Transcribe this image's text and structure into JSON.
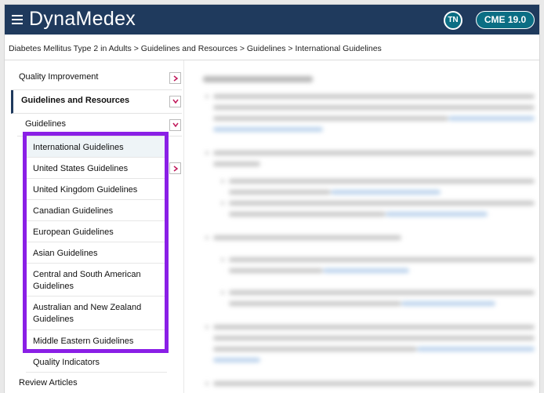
{
  "app": {
    "title": "DynaMedex"
  },
  "header": {
    "avatar_initials": "TN",
    "cme_label": "CME 19.0"
  },
  "breadcrumb": "Diabetes Mellitus Type 2 in Adults > Guidelines and Resources > Guidelines > International Guidelines",
  "sidebar": {
    "items": [
      {
        "label": "Quality Improvement"
      },
      {
        "label": "Guidelines and Resources"
      },
      {
        "label": "Guidelines"
      }
    ],
    "guidelines": [
      {
        "label": "International Guidelines"
      },
      {
        "label": "United States Guidelines"
      },
      {
        "label": "United Kingdom Guidelines"
      },
      {
        "label": "Canadian Guidelines"
      },
      {
        "label": "European Guidelines"
      },
      {
        "label": "Asian Guidelines"
      },
      {
        "label": "Central and South American Guidelines"
      },
      {
        "label": "Australian and New Zealand Guidelines"
      },
      {
        "label": "Middle Eastern Guidelines"
      },
      {
        "label": "Quality Indicators"
      }
    ],
    "review_articles": "Review Articles"
  },
  "colors": {
    "header": "#1f3a5d",
    "accent": "#0b6e84",
    "highlight": "#8a1fe6",
    "chevron": "#c0185a"
  }
}
